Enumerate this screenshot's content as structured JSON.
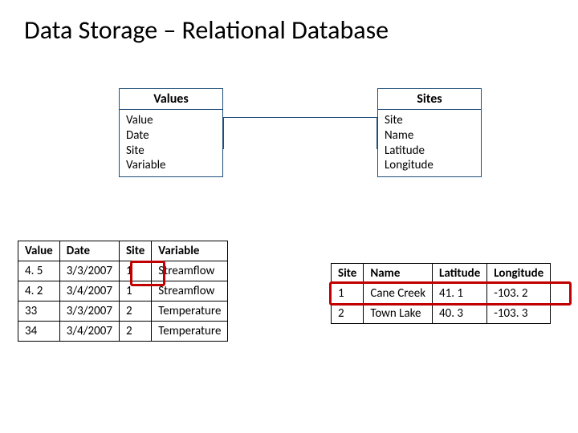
{
  "title": "Data Storage – Relational Database",
  "entities": {
    "values": {
      "name": "Values",
      "fields": [
        "Value",
        "Date",
        "Site",
        "Variable"
      ]
    },
    "sites": {
      "name": "Sites",
      "fields": [
        "Site",
        "Name",
        "Latitude",
        "Longitude"
      ]
    }
  },
  "values_table": {
    "headers": [
      "Value",
      "Date",
      "Site",
      "Variable"
    ],
    "rows": [
      [
        "4. 5",
        "3/3/2007",
        "1",
        "Streamflow"
      ],
      [
        "4. 2",
        "3/4/2007",
        "1",
        "Streamflow"
      ],
      [
        "33",
        "3/3/2007",
        "2",
        "Temperature"
      ],
      [
        "34",
        "3/4/2007",
        "2",
        "Temperature"
      ]
    ]
  },
  "sites_table": {
    "headers": [
      "Site",
      "Name",
      "Latitude",
      "Longitude"
    ],
    "rows": [
      [
        "1",
        "Cane Creek",
        "41. 1",
        "-103. 2"
      ],
      [
        "2",
        "Town Lake",
        "40. 3",
        "-103. 3"
      ]
    ]
  }
}
